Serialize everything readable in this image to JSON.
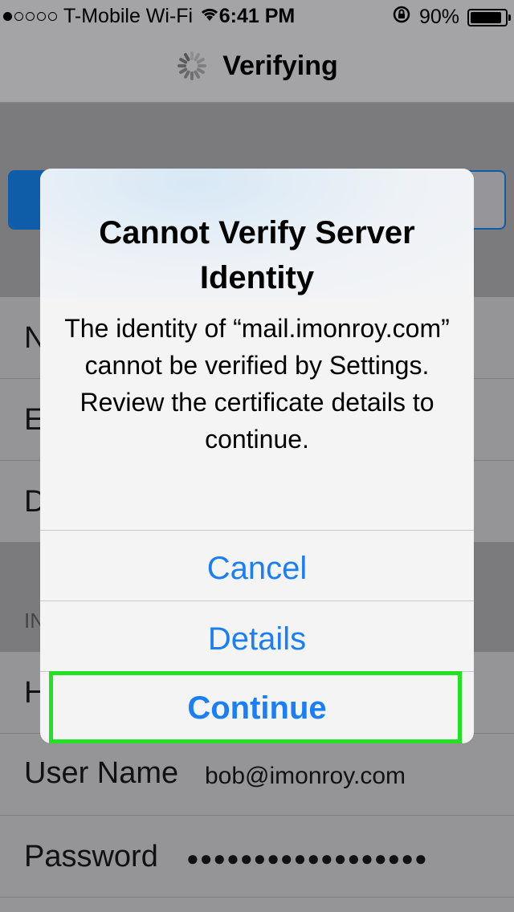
{
  "status_bar": {
    "signal_dots_filled": 1,
    "signal_dots_total": 5,
    "carrier": "T-Mobile Wi-Fi",
    "wifi_icon": "wifi-icon",
    "time": "6:41 PM",
    "rotation_lock_icon": "rotation-lock-icon",
    "battery_percent": "90%",
    "battery_level": 0.9
  },
  "nav": {
    "title": "Verifying",
    "spinner_icon": "activity-spinner-icon"
  },
  "background": {
    "row_initials": [
      "N",
      "E",
      "D"
    ],
    "section_header": "IN",
    "host_initial": "H",
    "user_name_label": "User Name",
    "user_name_value": "bob@imonroy.com",
    "password_label": "Password",
    "password_value": "●●●●●●●●●●●●●●●●●●"
  },
  "alert": {
    "title": "Cannot Verify Server Identity",
    "message": "The identity of “mail.imonroy.com” cannot be verified by Settings. Review the certificate details to continue.",
    "buttons": {
      "cancel": "Cancel",
      "details": "Details",
      "continue": "Continue"
    }
  },
  "colors": {
    "accent_blue": "#1a7ff5",
    "highlight_green": "#22e022"
  }
}
